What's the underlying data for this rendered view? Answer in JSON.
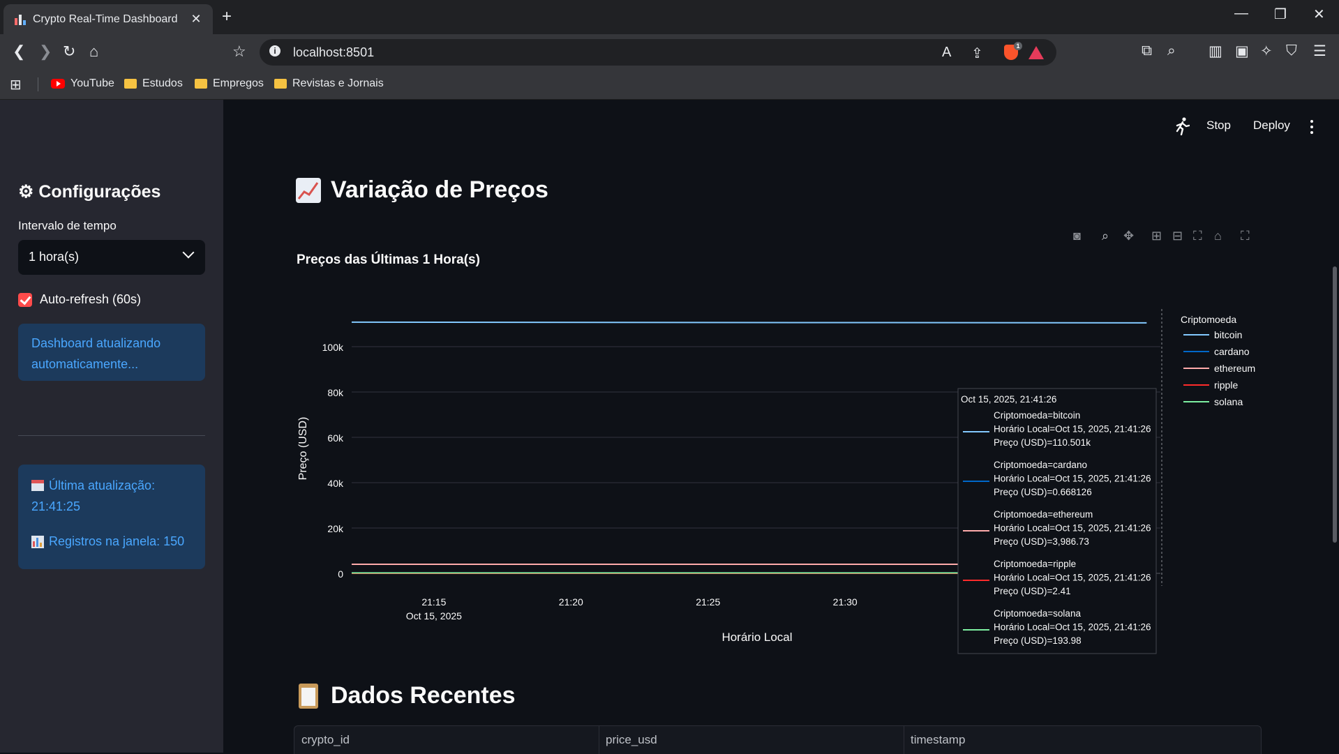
{
  "browser": {
    "tab_title": "Crypto Real-Time Dashboard",
    "url": "localhost:8501",
    "shield_count": "1",
    "bookmarks": [
      {
        "label": "YouTube",
        "icon": "youtube-icon"
      },
      {
        "label": "Estudos",
        "icon": "folder-icon"
      },
      {
        "label": "Empregos",
        "icon": "folder-icon"
      },
      {
        "label": "Revistas e Jornais",
        "icon": "folder-icon"
      }
    ]
  },
  "header": {
    "stop_label": "Stop",
    "deploy_label": "Deploy"
  },
  "sidebar": {
    "title": "Configurações",
    "interval_label": "Intervalo de tempo",
    "interval_value": "1 hora(s)",
    "autorefresh_label": "Auto-refresh (60s)",
    "autorefresh_checked": true,
    "info_line1": "Dashboard atualizando",
    "info_line2": "automaticamente...",
    "last_update_line1": "Última atualização:",
    "last_update_line2": "21:41:25",
    "records": "Registros na janela: 150"
  },
  "main": {
    "title": "Variação de Preços",
    "recent_title": "Dados Recentes",
    "table_columns": [
      "crypto_id",
      "price_usd",
      "timestamp"
    ]
  },
  "colors": {
    "accent": "#ff4b4b",
    "info_bg": "#1c3a5c",
    "info_text": "#4aa7ff",
    "bitcoin": "#83c9ff",
    "cardano": "#0068c9",
    "ethereum": "#ffabab",
    "ripple": "#ff2b2b",
    "solana": "#7defa1"
  },
  "chart_data": {
    "type": "line",
    "title": "Preços das Últimas 1 Hora(s)",
    "xlabel": "Horário Local",
    "ylabel": "Preço (USD)",
    "x_ticks": [
      "21:15",
      "21:20",
      "21:25",
      "21:30"
    ],
    "x_tick_date": "Oct 15, 2025",
    "y_ticks": [
      "0",
      "20k",
      "40k",
      "60k",
      "80k",
      "100k"
    ],
    "ylim": [
      0,
      115000
    ],
    "grid": true,
    "legend_title": "Criptomoeda",
    "legend_position": "right",
    "x": [
      "21:12",
      "21:41"
    ],
    "series": [
      {
        "name": "bitcoin",
        "values": [
          110800,
          110501
        ]
      },
      {
        "name": "cardano",
        "values": [
          0.67,
          0.668126
        ]
      },
      {
        "name": "ethereum",
        "values": [
          3990,
          3986.73
        ]
      },
      {
        "name": "ripple",
        "values": [
          2.4,
          2.41
        ]
      },
      {
        "name": "solana",
        "values": [
          194,
          193.98
        ]
      }
    ],
    "tooltip": {
      "header": "Oct 15, 2025, 21:41:26",
      "entries": [
        {
          "series": "Criptomoeda=bitcoin",
          "time": "Horário Local=Oct 15, 2025, 21:41:26",
          "price": "Preço (USD)=110.501k"
        },
        {
          "series": "Criptomoeda=cardano",
          "time": "Horário Local=Oct 15, 2025, 21:41:26",
          "price": "Preço (USD)=0.668126"
        },
        {
          "series": "Criptomoeda=ethereum",
          "time": "Horário Local=Oct 15, 2025, 21:41:26",
          "price": "Preço (USD)=3,986.73"
        },
        {
          "series": "Criptomoeda=ripple",
          "time": "Horário Local=Oct 15, 2025, 21:41:26",
          "price": "Preço (USD)=2.41"
        },
        {
          "series": "Criptomoeda=solana",
          "time": "Horário Local=Oct 15, 2025, 21:41:26",
          "price": "Preço (USD)=193.98"
        }
      ]
    }
  }
}
